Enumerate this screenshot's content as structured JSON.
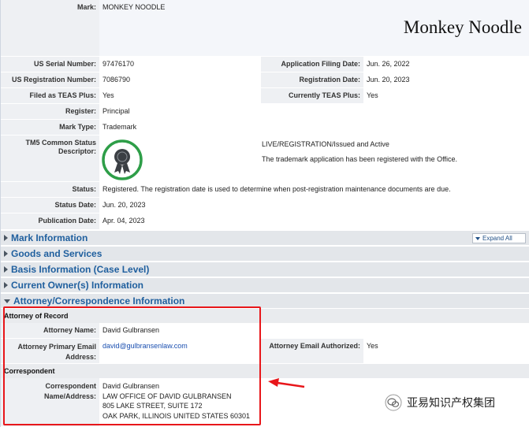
{
  "mark": {
    "label": "Mark:",
    "value": "MONKEY NOODLE",
    "display": "Monkey Noodle"
  },
  "serial": {
    "label": "US Serial Number:",
    "value": "97476170"
  },
  "filing_date": {
    "label": "Application Filing Date:",
    "value": "Jun. 26, 2022"
  },
  "registration_number": {
    "label": "US Registration Number:",
    "value": "7086790"
  },
  "registration_date": {
    "label": "Registration Date:",
    "value": "Jun. 20, 2023"
  },
  "teas_plus": {
    "label": "Filed as TEAS Plus:",
    "value": "Yes"
  },
  "currently_teas_plus": {
    "label": "Currently TEAS Plus:",
    "value": "Yes"
  },
  "register": {
    "label": "Register:",
    "value": "Principal"
  },
  "mark_type": {
    "label": "Mark Type:",
    "value": "Trademark"
  },
  "tm5": {
    "label": "TM5 Common Status Descriptor:",
    "icon": "award-ribbon-icon",
    "icon_color": "#2e9e48",
    "status_line": "LIVE/REGISTRATION/Issued and Active",
    "status_desc": "The trademark application has been registered with the Office."
  },
  "status": {
    "label": "Status:",
    "value": "Registered. The registration date is used to determine when post-registration maintenance documents are due."
  },
  "status_date": {
    "label": "Status Date:",
    "value": "Jun. 20, 2023"
  },
  "publication_date": {
    "label": "Publication Date:",
    "value": "Apr. 04, 2023"
  },
  "sections": {
    "mark_info": "Mark Information",
    "goods": "Goods and Services",
    "basis": "Basis Information (Case Level)",
    "owner": "Current Owner(s) Information",
    "attorney": "Attorney/Correspondence Information"
  },
  "expand_all": "Expand All",
  "attorney": {
    "heading": "Attorney of Record",
    "name_label": "Attorney Name:",
    "name": "David Gulbransen",
    "email_label": "Attorney Primary Email Address:",
    "email": "david@gulbransenlaw.com",
    "authorized_label": "Attorney Email Authorized:",
    "authorized": "Yes"
  },
  "correspondent": {
    "heading": "Correspondent",
    "label": "Correspondent Name/Address:",
    "lines": [
      "David Gulbransen",
      "LAW OFFICE OF DAVID GULBRANSEN",
      "805 LAKE STREET, SUITE 172",
      "OAK PARK, ILLINOIS UNITED STATES 60301"
    ]
  },
  "watermark": {
    "icon": "wechat-icon",
    "text": "亚易知识产权集团"
  },
  "colors": {
    "highlight": "#e8161a",
    "section_title": "#1f5f9e",
    "label_bg": "#eef0f3"
  }
}
